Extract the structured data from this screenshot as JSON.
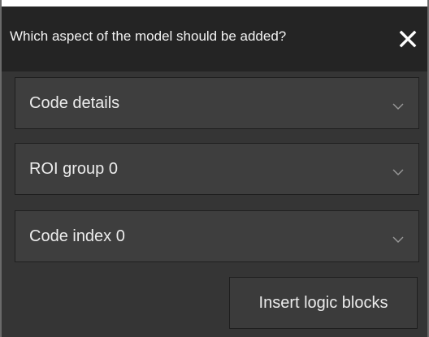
{
  "dialog": {
    "title": "Which aspect of the model should be added?",
    "close_icon": "close-icon"
  },
  "selects": [
    {
      "value": "Code details",
      "icon": "chevron-down-icon"
    },
    {
      "value": "ROI group 0",
      "icon": "chevron-down-icon"
    },
    {
      "value": "Code index 0",
      "icon": "chevron-down-icon"
    }
  ],
  "actions": {
    "insert_label": "Insert logic blocks"
  },
  "colors": {
    "header_bg": "#242424",
    "body_bg": "#353535",
    "control_bg": "#3e3e3e",
    "text": "#ececec"
  }
}
